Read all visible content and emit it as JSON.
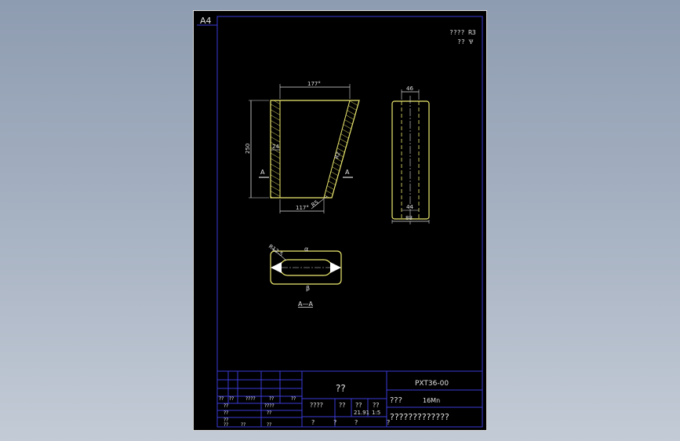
{
  "sheet": {
    "size_label": "A4",
    "roughness_note_1": "???? R3",
    "roughness_note_2": "?? Ѱ"
  },
  "front_view": {
    "dim_top": "177°",
    "dim_height": "250",
    "dim_wall": "24",
    "dim_bottom": "117°",
    "dim_r": "R5",
    "dim_slant": "R2",
    "section_mark_left": "A",
    "section_mark_right": "A"
  },
  "side_view": {
    "dim_top": "46",
    "dim_inner": "44",
    "dim_bottom": "88"
  },
  "section_view": {
    "dim_radius": "R12.5",
    "dim_top_mark": "α",
    "dim_bottom_mark": "β",
    "label": "A—A"
  },
  "title_block": {
    "part_name": "??",
    "drawing_number": "PXT36-00",
    "material_label": "???",
    "material": "16Mn",
    "company": "?????????????",
    "stage_label": "????",
    "weight_label": "??",
    "scale_label": "??",
    "mass_label": "??",
    "weight_value": "21.91",
    "scale_value": "1:5",
    "sheet_q1": "?",
    "sheet_q2": "?",
    "sheet_q3": "?",
    "sheet_q4": "?",
    "rev_h1": "??",
    "rev_h2": "??",
    "rev_h3": "????",
    "rev_h4": "??",
    "rev_h5": "??",
    "rev_r1c1": "??",
    "rev_r1c2": "????",
    "rev_r2c1": "??",
    "rev_r2c2": "??",
    "rev_r3c1": "??",
    "rev_r4c1": "??",
    "rev_r5c1": "??",
    "rev_r5c2": "??"
  }
}
